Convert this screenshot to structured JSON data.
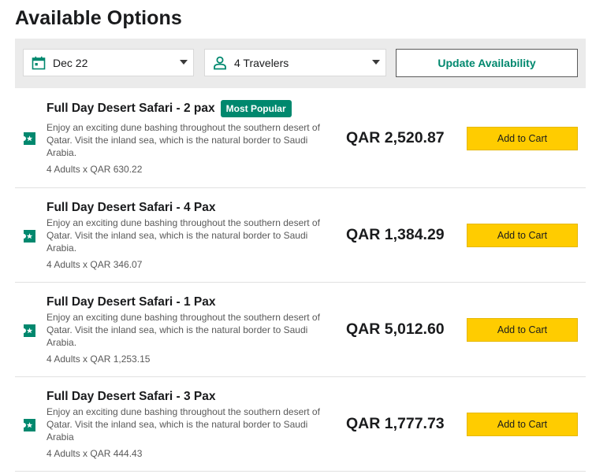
{
  "page": {
    "title": "Available Options"
  },
  "filters": {
    "date": {
      "value": "Dec 22",
      "icon": "calendar-icon"
    },
    "travelers": {
      "value": "4 Travelers",
      "icon": "person-icon"
    },
    "update_label": "Update Availability"
  },
  "options": [
    {
      "title": "Full Day Desert Safari - 2 pax",
      "badge": "Most Popular",
      "description": "Enjoy an exciting dune bashing throughout the southern desert of Qatar. Visit the inland sea, which is the natural border to Saudi Arabia.",
      "breakdown": "4 Adults x QAR 630.22",
      "price": "QAR 2,520.87",
      "cart_label": "Add to Cart"
    },
    {
      "title": "Full Day Desert Safari - 4 Pax",
      "badge": "",
      "description": "Enjoy an exciting dune bashing throughout the southern desert of Qatar. Visit the inland sea, which is the natural border to Saudi Arabia.",
      "breakdown": "4 Adults x QAR 346.07",
      "price": "QAR 1,384.29",
      "cart_label": "Add to Cart"
    },
    {
      "title": "Full Day Desert Safari - 1 Pax",
      "badge": "",
      "description": "Enjoy an exciting dune bashing throughout the southern desert of Qatar. Visit the inland sea, which is the natural border to Saudi Arabia.",
      "breakdown": "4 Adults x QAR 1,253.15",
      "price": "QAR 5,012.60",
      "cart_label": "Add to Cart"
    },
    {
      "title": "Full Day Desert Safari - 3 Pax",
      "badge": "",
      "description": "Enjoy an exciting dune bashing throughout the southern desert of Qatar. Visit the inland sea, which is the natural border to Saudi Arabia",
      "breakdown": "4 Adults x QAR 444.43",
      "price": "QAR 1,777.73",
      "cart_label": "Add to Cart"
    }
  ],
  "colors": {
    "accent_green": "#00886e",
    "cart_yellow": "#ffcc00",
    "filter_bar_bg": "#ebebeb",
    "text_primary": "#1a1b1d",
    "text_secondary": "#595959"
  },
  "icons": {
    "row_icon": "ticket-icon",
    "dropdown": "chevron-down-icon"
  }
}
